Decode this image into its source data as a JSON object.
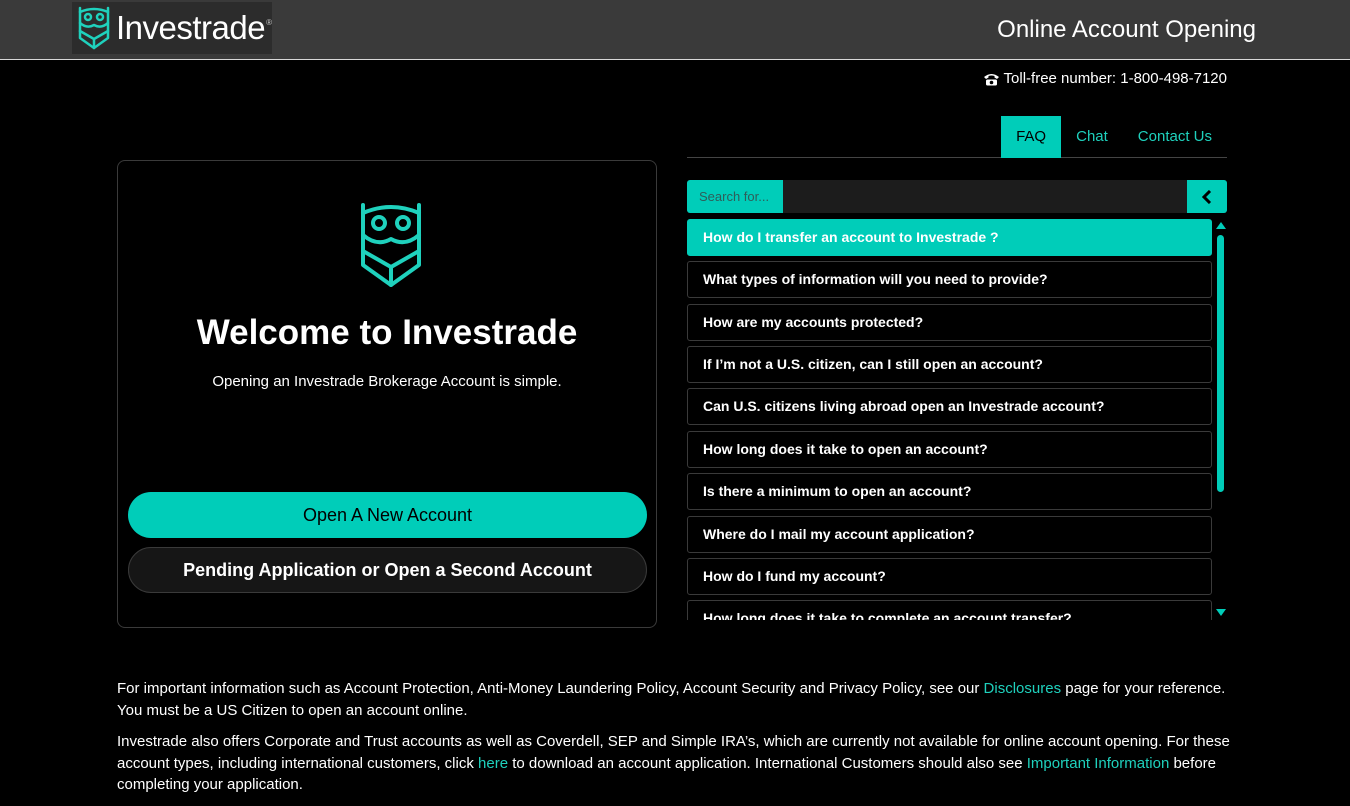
{
  "header": {
    "brand": "Investrade",
    "registered": "®",
    "title": "Online Account Opening"
  },
  "contact": {
    "phone_icon": "phone-icon",
    "phone_text": "Toll-free number: 1-800-498-7120"
  },
  "tabs": [
    {
      "label": "FAQ",
      "active": true
    },
    {
      "label": "Chat",
      "active": false
    },
    {
      "label": "Contact Us",
      "active": false
    }
  ],
  "welcome": {
    "title": "Welcome to Investrade",
    "subtitle": "Opening an Investrade Brokerage Account is simple.",
    "open_button": "Open A New Account",
    "pending_button": "Pending Application or Open a Second Account"
  },
  "faq": {
    "search_placeholder": "Search for...",
    "items": [
      {
        "q": "How do I transfer an account to Investrade ?",
        "active": true
      },
      {
        "q": "What types of information will you need to provide?"
      },
      {
        "q": "How are my accounts protected?"
      },
      {
        "q": "If I’m not a U.S. citizen, can I still open an account?"
      },
      {
        "q": "Can U.S. citizens living abroad open an Investrade account?"
      },
      {
        "q": "How long does it take to open an account?"
      },
      {
        "q": "Is there a minimum to open an account?"
      },
      {
        "q": "Where do I mail my account application?"
      },
      {
        "q": "How do I fund my account?"
      },
      {
        "q": "How long does it take to complete an account transfer?"
      }
    ]
  },
  "footer": {
    "p1_a": "For important information such as Account Protection, Anti-Money Laundering Policy, Account Security and Privacy Policy, see our ",
    "p1_link": "Disclosures",
    "p1_b": " page for your reference. You must be a US Citizen to open an account online.",
    "p2_a": "Investrade also offers Corporate and Trust accounts as well as Coverdell, SEP and Simple IRA’s, which are currently not available for online account opening. For these account types, including international customers, click ",
    "p2_link1": "here",
    "p2_b": " to download an account application. International Customers should also see ",
    "p2_link2": "Important Information",
    "p2_c": " before completing your application."
  },
  "colors": {
    "accent": "#00cdb9",
    "link": "#1fd1bd",
    "header_bg": "#3a3a3a",
    "page_bg": "#000000"
  }
}
